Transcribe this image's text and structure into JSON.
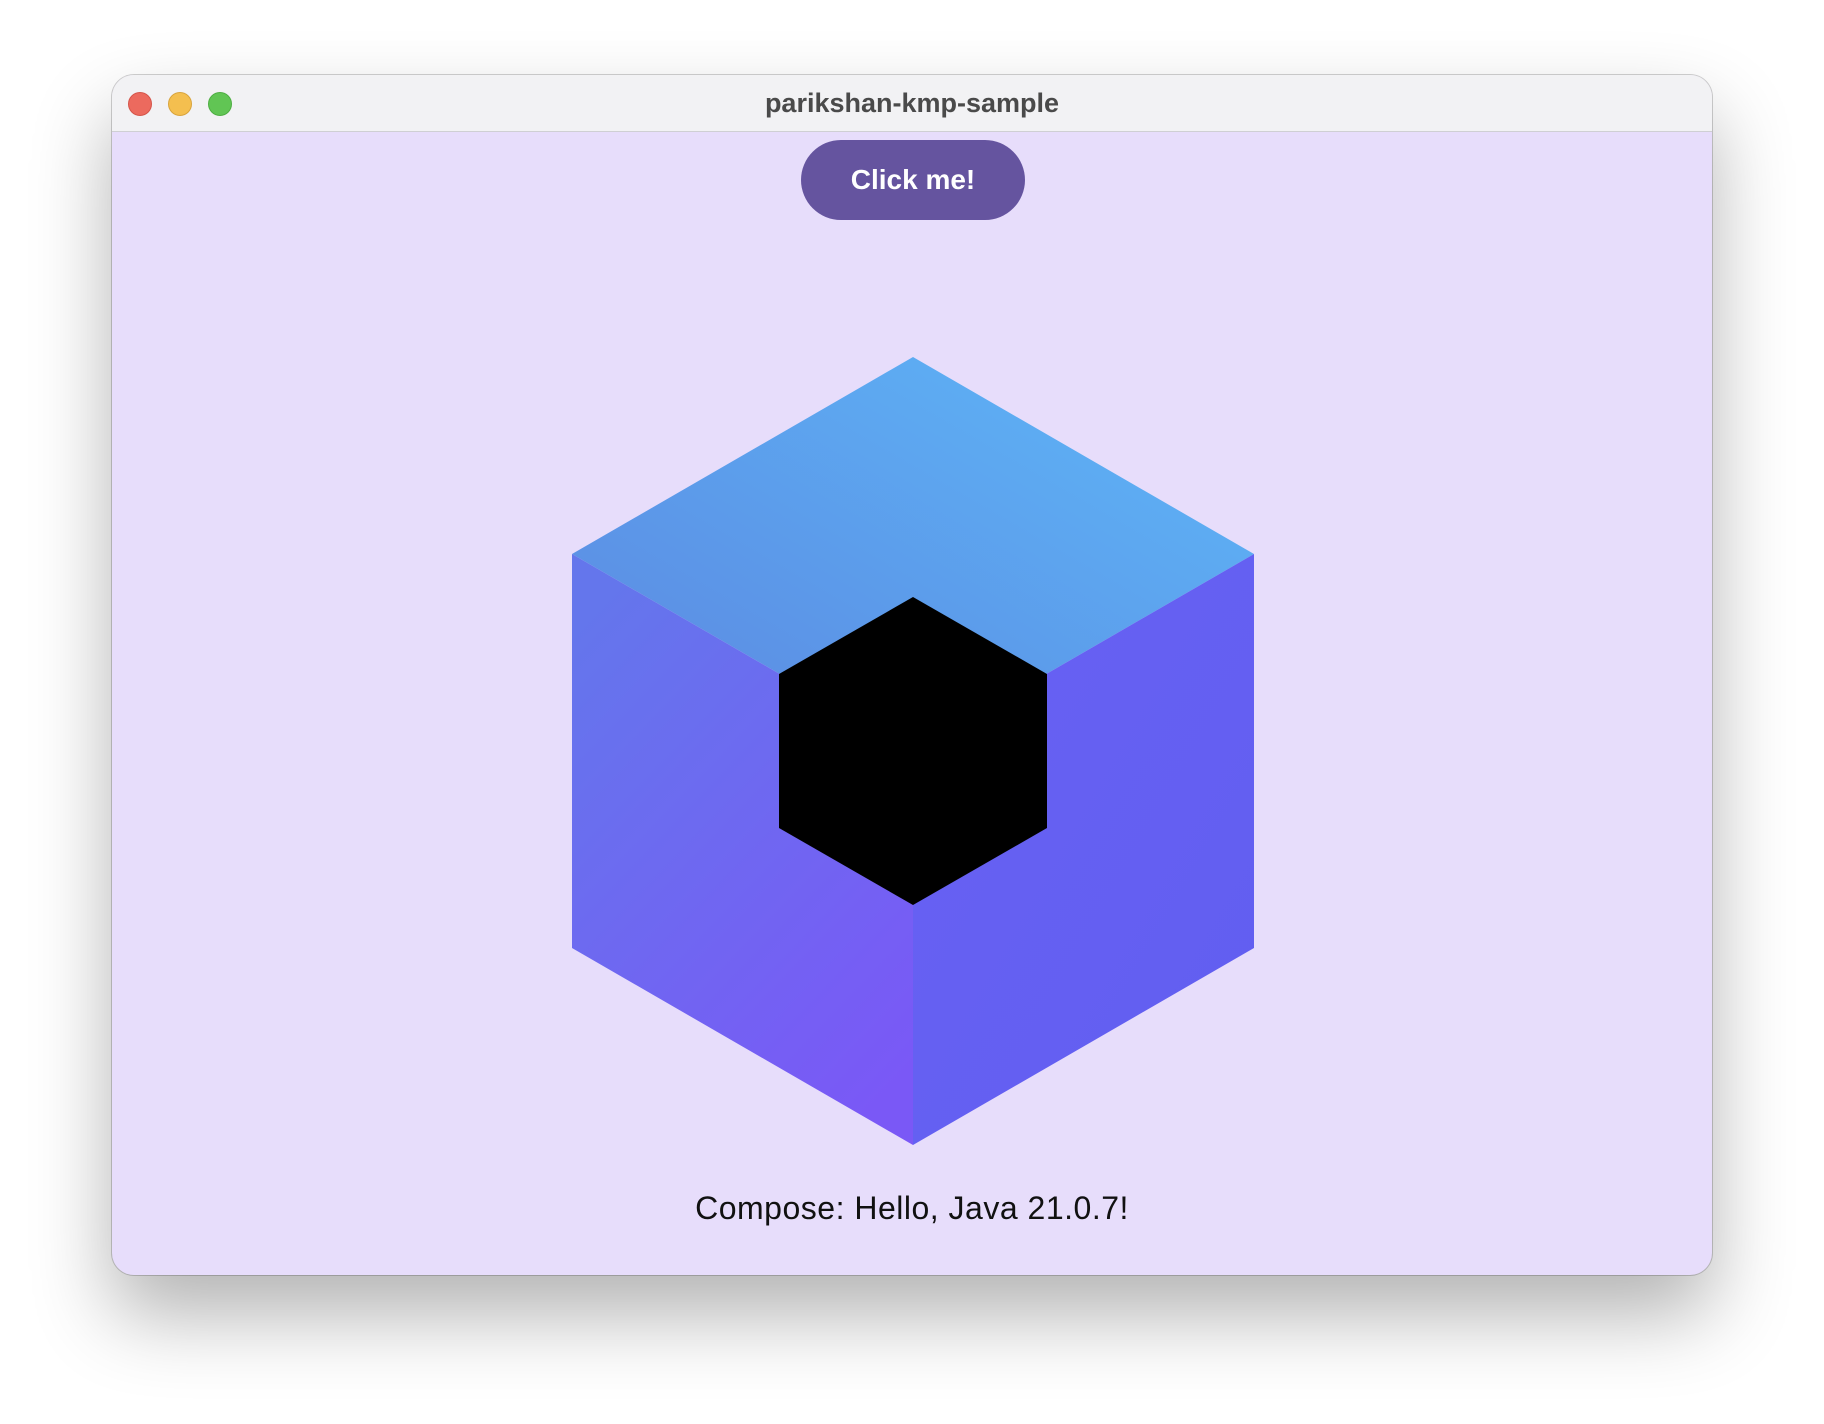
{
  "window": {
    "title": "parikshan-kmp-sample"
  },
  "main": {
    "button_label": "Click me!",
    "greeting": "Compose: Hello, Java 21.0.7!"
  },
  "colors": {
    "background": "#E7DDFB",
    "button": "#65549F",
    "cube_top_start": "#5B86E0",
    "cube_top_end": "#5EB8F8",
    "cube_left_top": "#6476EC",
    "cube_left_bottom": "#7A58F6",
    "cube_right": "#6560F2",
    "cube_hole": "#000000"
  },
  "icons": {
    "logo": "compose-multiplatform-logo-icon"
  }
}
